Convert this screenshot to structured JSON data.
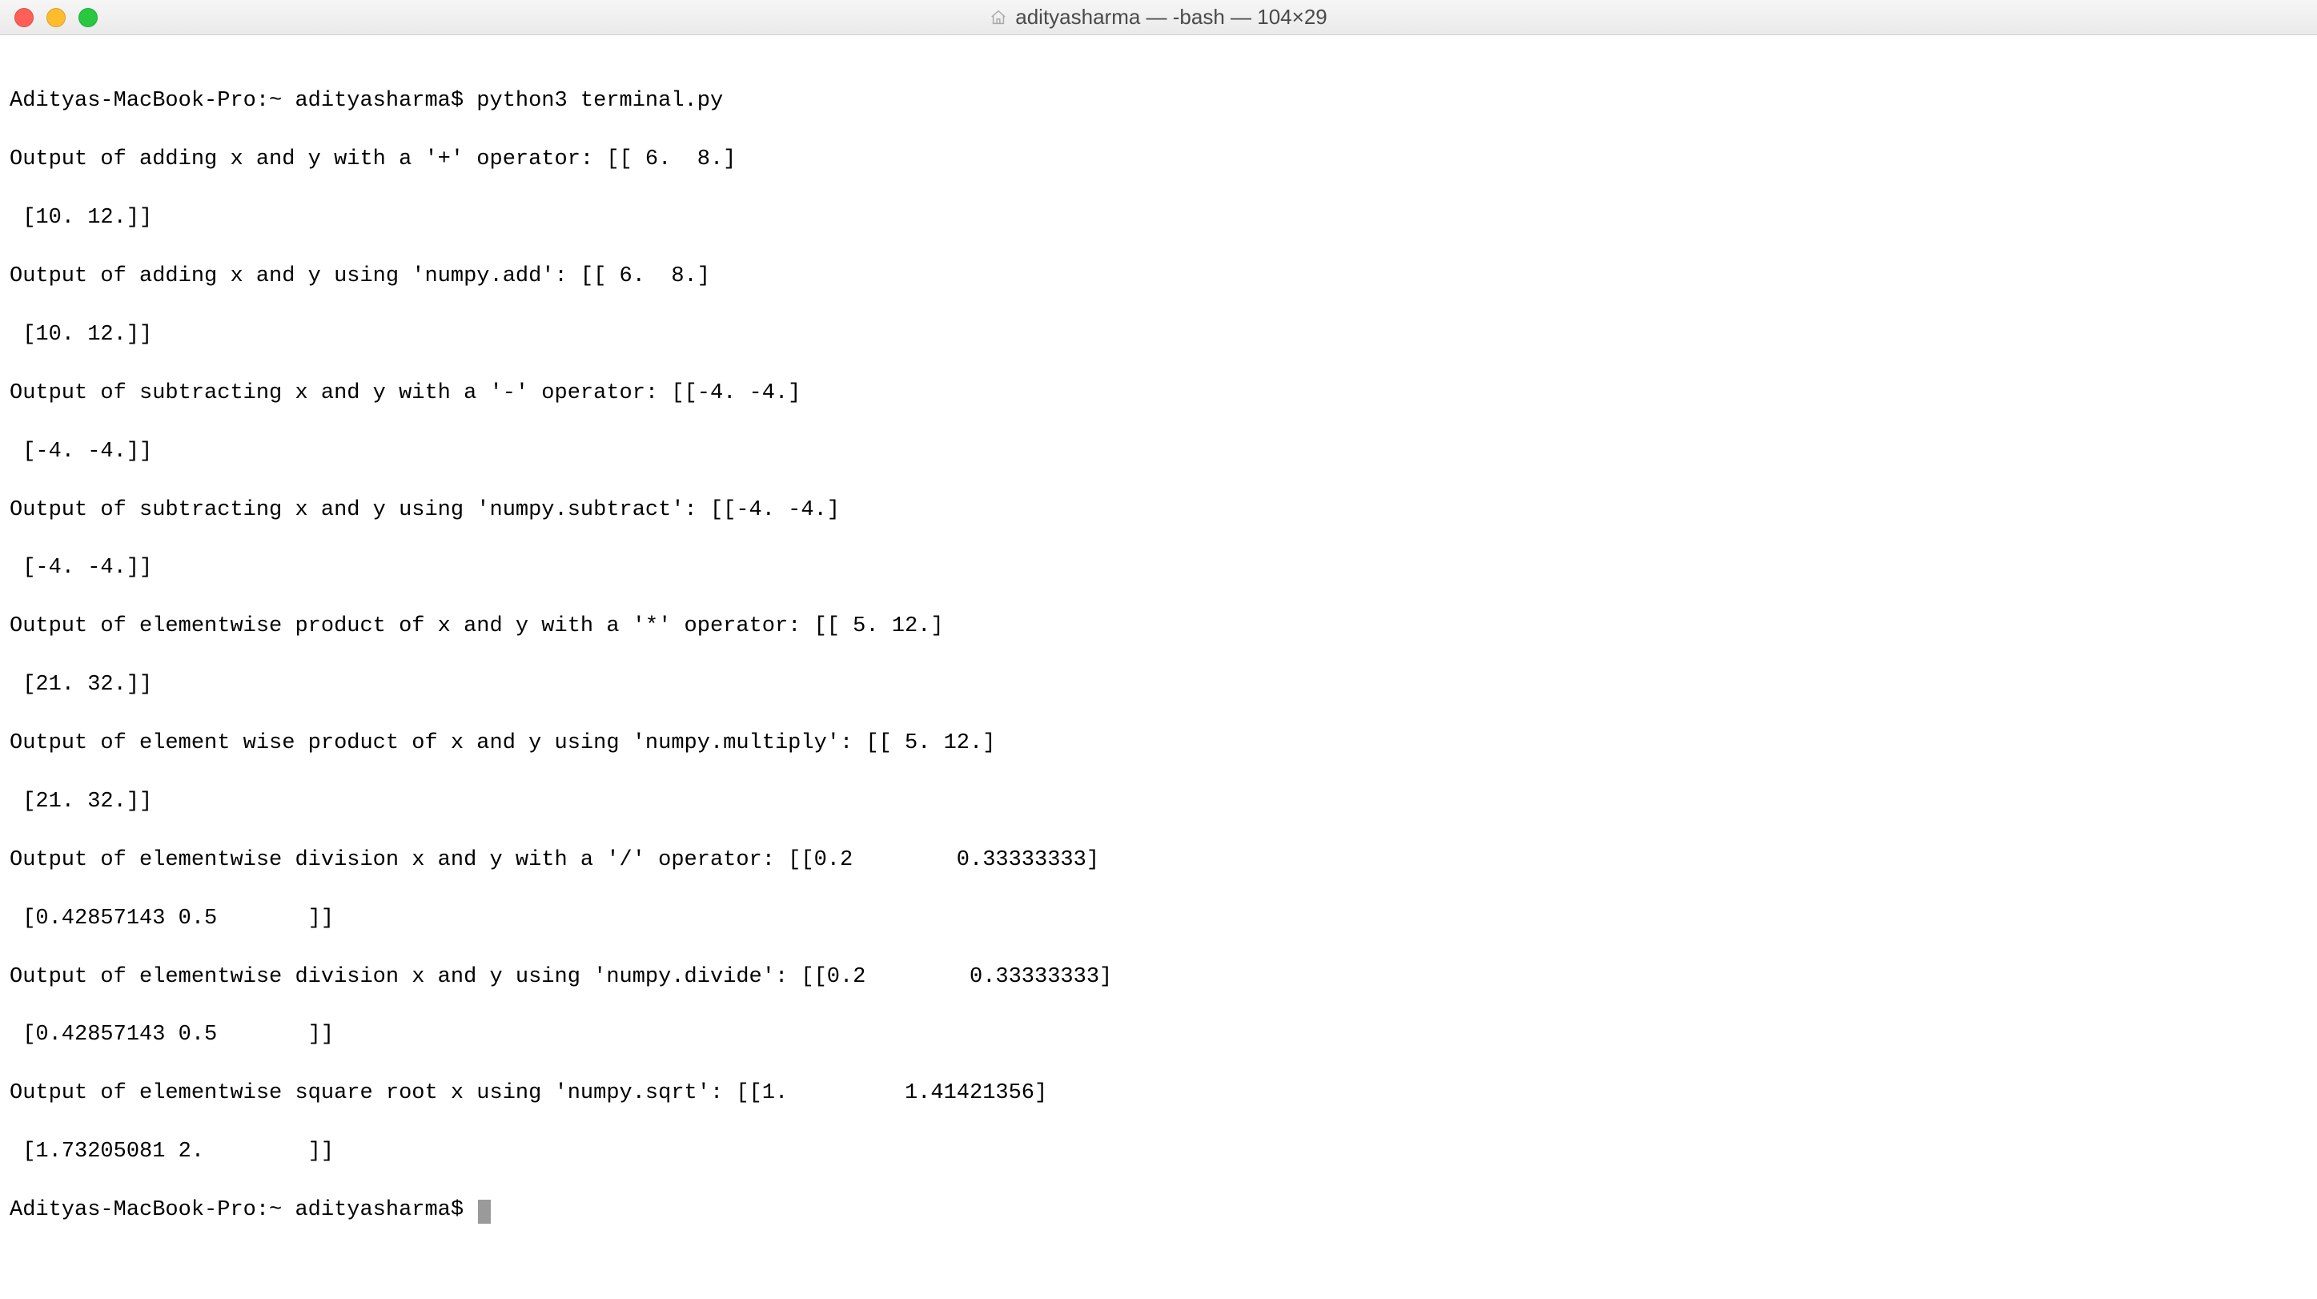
{
  "window": {
    "title": "adityasharma — -bash — 104×29"
  },
  "prompt1": {
    "host": "Adityas-MacBook-Pro",
    "path": "~",
    "user": "adityasharma",
    "symbol": "$",
    "command": "python3 terminal.py",
    "full": "Adityas-MacBook-Pro:~ adityasharma$ python3 terminal.py"
  },
  "output": {
    "l1": "Output of adding x and y with a '+' operator: [[ 6.  8.]",
    "l2": " [10. 12.]]",
    "l3": "Output of adding x and y using 'numpy.add': [[ 6.  8.]",
    "l4": " [10. 12.]]",
    "l5": "Output of subtracting x and y with a '-' operator: [[-4. -4.]",
    "l6": " [-4. -4.]]",
    "l7": "Output of subtracting x and y using 'numpy.subtract': [[-4. -4.]",
    "l8": " [-4. -4.]]",
    "l9": "Output of elementwise product of x and y with a '*' operator: [[ 5. 12.]",
    "l10": " [21. 32.]]",
    "l11": "Output of element wise product of x and y using 'numpy.multiply': [[ 5. 12.]",
    "l12": " [21. 32.]]",
    "l13": "Output of elementwise division x and y with a '/' operator: [[0.2        0.33333333]",
    "l14": " [0.42857143 0.5       ]]",
    "l15": "Output of elementwise division x and y using 'numpy.divide': [[0.2        0.33333333]",
    "l16": " [0.42857143 0.5       ]]",
    "l17": "Output of elementwise square root x using 'numpy.sqrt': [[1.         1.41421356]",
    "l18": " [1.73205081 2.        ]]"
  },
  "prompt2": {
    "full": "Adityas-MacBook-Pro:~ adityasharma$ "
  }
}
